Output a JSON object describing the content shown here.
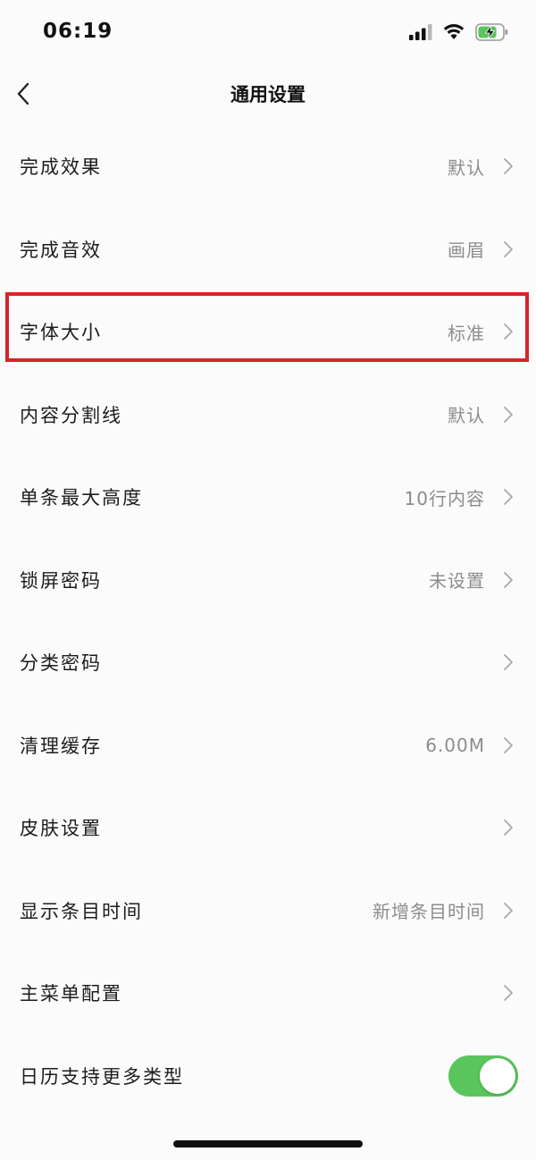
{
  "status_bar": {
    "time": "06:19",
    "icons": [
      "signal-icon",
      "wifi-icon",
      "battery-charging-icon"
    ]
  },
  "nav": {
    "title": "通用设置",
    "back_icon": "chevron-left-icon"
  },
  "settings": [
    {
      "label": "完成效果",
      "value": "默认"
    },
    {
      "label": "完成音效",
      "value": "画眉"
    },
    {
      "label": "字体大小",
      "value": "标准"
    },
    {
      "label": "内容分割线",
      "value": "默认"
    },
    {
      "label": "单条最大高度",
      "value": "10行内容"
    },
    {
      "label": "锁屏密码",
      "value": "未设置"
    },
    {
      "label": "分类密码",
      "value": ""
    },
    {
      "label": "清理缓存",
      "value": "6.00M"
    },
    {
      "label": "皮肤设置",
      "value": ""
    },
    {
      "label": "显示条目时间",
      "value": "新增条目时间"
    },
    {
      "label": "主菜单配置",
      "value": ""
    },
    {
      "label": "日历支持更多类型",
      "toggle": true
    }
  ],
  "colors": {
    "highlight_border": "#d9222a",
    "toggle_on": "#5ac55c",
    "value_text": "#8c8c8c",
    "battery_charging": "#5ac55c"
  }
}
